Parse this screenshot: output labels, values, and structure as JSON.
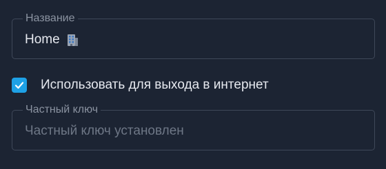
{
  "name_field": {
    "label": "Название",
    "value": "Home",
    "icon": "office-building-icon"
  },
  "exit_checkbox": {
    "label": "Использовать для выхода в интернет",
    "checked": true,
    "accent_color": "#1ea1e6"
  },
  "private_key_field": {
    "label": "Частный ключ",
    "placeholder": "Частный ключ установлен"
  }
}
